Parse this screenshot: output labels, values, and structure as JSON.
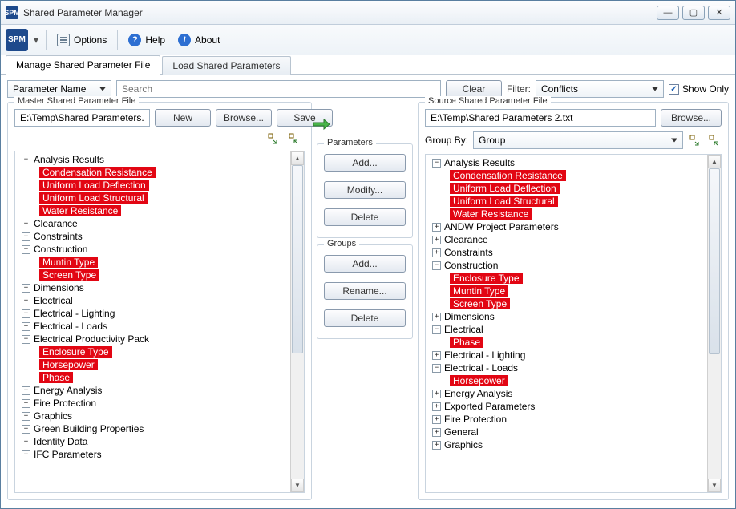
{
  "window": {
    "title": "Shared Parameter Manager",
    "logo": "SPM",
    "drop_glyph": "▾",
    "min": "—",
    "max": "▢",
    "close": "✕"
  },
  "toolbar": {
    "options": "Options",
    "help": "Help",
    "about": "About"
  },
  "tabs": {
    "manage": "Manage Shared Parameter File",
    "load": "Load Shared Parameters"
  },
  "search": {
    "dropdown": "Parameter Name",
    "placeholder": "Search",
    "clear": "Clear",
    "filter_label": "Filter:",
    "filter_value": "Conflicts",
    "show_only": "Show Only",
    "checked": "✓"
  },
  "master": {
    "title": "Master Shared Parameter File",
    "path": "E:\\Temp\\Shared Parameters.txt",
    "new_btn": "New",
    "browse_btn": "Browse...",
    "save_btn": "Save"
  },
  "source": {
    "title": "Source Shared Parameter File",
    "path": "E:\\Temp\\Shared Parameters 2.txt",
    "browse_btn": "Browse...",
    "groupby_label": "Group By:",
    "groupby_value": "Group"
  },
  "center": {
    "params_title": "Parameters",
    "params_add": "Add...",
    "params_modify": "Modify...",
    "params_delete": "Delete",
    "groups_title": "Groups",
    "groups_add": "Add...",
    "groups_rename": "Rename...",
    "groups_delete": "Delete"
  },
  "tree_master": [
    {
      "label": "Analysis Results",
      "expanded": true,
      "children": [
        {
          "label": "Condensation Resistance",
          "conflict": true
        },
        {
          "label": "Uniform Load Deflection",
          "conflict": true
        },
        {
          "label": "Uniform Load Structural",
          "conflict": true
        },
        {
          "label": "Water Resistance",
          "conflict": true
        }
      ]
    },
    {
      "label": "Clearance",
      "children": []
    },
    {
      "label": "Constraints",
      "children": []
    },
    {
      "label": "Construction",
      "expanded": true,
      "children": [
        {
          "label": "Muntin Type",
          "conflict": true
        },
        {
          "label": "Screen Type",
          "conflict": true
        }
      ]
    },
    {
      "label": "Dimensions",
      "children": []
    },
    {
      "label": "Electrical",
      "children": []
    },
    {
      "label": "Electrical - Lighting",
      "children": []
    },
    {
      "label": "Electrical - Loads",
      "children": []
    },
    {
      "label": "Electrical Productivity Pack",
      "expanded": true,
      "children": [
        {
          "label": "Enclosure Type",
          "conflict": true
        },
        {
          "label": "Horsepower",
          "conflict": true
        },
        {
          "label": "Phase",
          "conflict": true
        }
      ]
    },
    {
      "label": "Energy Analysis",
      "children": []
    },
    {
      "label": "Fire Protection",
      "children": []
    },
    {
      "label": "Graphics",
      "children": []
    },
    {
      "label": "Green Building Properties",
      "children": []
    },
    {
      "label": "Identity Data",
      "children": []
    },
    {
      "label": "IFC Parameters",
      "children": []
    }
  ],
  "tree_source": [
    {
      "label": "Analysis Results",
      "expanded": true,
      "children": [
        {
          "label": "Condensation Resistance",
          "conflict": true
        },
        {
          "label": "Uniform Load Deflection",
          "conflict": true
        },
        {
          "label": "Uniform Load Structural",
          "conflict": true
        },
        {
          "label": "Water Resistance",
          "conflict": true
        }
      ]
    },
    {
      "label": "ANDW Project Parameters",
      "children": []
    },
    {
      "label": "Clearance",
      "children": []
    },
    {
      "label": "Constraints",
      "children": []
    },
    {
      "label": "Construction",
      "expanded": true,
      "children": [
        {
          "label": "Enclosure Type",
          "conflict": true
        },
        {
          "label": "Muntin Type",
          "conflict": true
        },
        {
          "label": "Screen Type",
          "conflict": true
        }
      ]
    },
    {
      "label": "Dimensions",
      "children": []
    },
    {
      "label": "Electrical",
      "expanded": true,
      "children": [
        {
          "label": "Phase",
          "conflict": true
        }
      ]
    },
    {
      "label": "Electrical - Lighting",
      "children": []
    },
    {
      "label": "Electrical - Loads",
      "expanded": true,
      "children": [
        {
          "label": "Horsepower",
          "conflict": true
        }
      ]
    },
    {
      "label": "Energy Analysis",
      "children": []
    },
    {
      "label": "Exported Parameters",
      "children": []
    },
    {
      "label": "Fire Protection",
      "children": []
    },
    {
      "label": "General",
      "children": []
    },
    {
      "label": "Graphics",
      "children": []
    }
  ]
}
